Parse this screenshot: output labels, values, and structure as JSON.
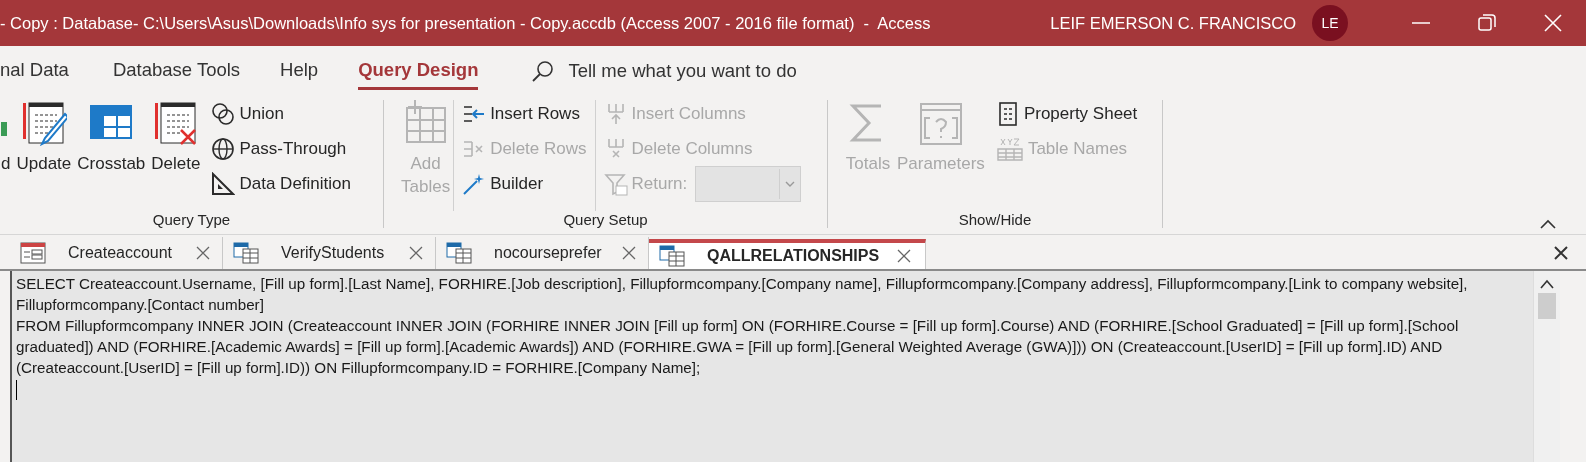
{
  "title_bar": {
    "title": "- Copy : Database- C:\\Users\\Asus\\Downloads\\Info sys for presentation - Copy.accdb (Access 2007 - 2016 file format)  -  Access",
    "user": "LEIF EMERSON C. FRANCISCO",
    "avatar": "LE"
  },
  "menu_tabs": [
    {
      "label": "nal Data",
      "selected": false
    },
    {
      "label": "Database Tools",
      "selected": false
    },
    {
      "label": "Help",
      "selected": false
    },
    {
      "label": "Query Design",
      "selected": true
    }
  ],
  "search": {
    "placeholder": "Tell me what you want to do"
  },
  "ribbon_groups": [
    {
      "label": "Query Type",
      "dividers": false,
      "items": [
        {
          "kind": "large",
          "label": "d",
          "disabled": false
        },
        {
          "kind": "large",
          "label": "Update",
          "disabled": false
        },
        {
          "kind": "large",
          "label": "Crosstab",
          "disabled": false
        },
        {
          "kind": "large",
          "label": "Delete",
          "disabled": false
        },
        {
          "kind": "small",
          "label": "Union",
          "disabled": false
        },
        {
          "kind": "small",
          "label": "Pass-Through",
          "disabled": false
        },
        {
          "kind": "small",
          "label": "Data Definition",
          "disabled": false
        }
      ]
    },
    {
      "label": "Query Setup",
      "dividers": true,
      "items": [
        {
          "kind": "large",
          "label": "Add\nTables",
          "disabled": true
        },
        {
          "kind": "small",
          "label": "Insert Rows",
          "disabled": false
        },
        {
          "kind": "small",
          "label": "Delete Rows",
          "disabled": true
        },
        {
          "kind": "small",
          "label": "Builder",
          "disabled": false
        },
        {
          "kind": "small",
          "label": "Insert Columns",
          "disabled": true
        },
        {
          "kind": "small",
          "label": "Delete Columns",
          "disabled": true
        },
        {
          "kind": "combo",
          "label": "Return:",
          "disabled": true
        }
      ]
    },
    {
      "label": "Show/Hide",
      "dividers": false,
      "items": [
        {
          "kind": "large",
          "label": "Totals",
          "disabled": true
        },
        {
          "kind": "large",
          "label": "Parameters",
          "disabled": true
        },
        {
          "kind": "small",
          "label": "Property Sheet",
          "disabled": false
        },
        {
          "kind": "small",
          "label": "Table Names",
          "disabled": true
        }
      ]
    }
  ],
  "doc_tabs": [
    {
      "kind": "form",
      "label": "Createaccount",
      "selected": false
    },
    {
      "kind": "query",
      "label": "VerifyStudents",
      "selected": false
    },
    {
      "kind": "query",
      "label": "nocourseprefer",
      "selected": false
    },
    {
      "kind": "query",
      "label": "QALLRELATIONSHIPS",
      "selected": true
    }
  ],
  "sql_lines": [
    "SELECT Createaccount.Username, [Fill up form].[Last Name], FORHIRE.[Job description], Fillupformcompany.[Company name], Fillupformcompany.[Company address], Fillupformcompany.[Link to company website],",
    "Fillupformcompany.[Contact number]",
    "FROM Fillupformcompany INNER JOIN (Createaccount INNER JOIN (FORHIRE INNER JOIN [Fill up form] ON (FORHIRE.Course = [Fill up form].Course) AND (FORHIRE.[School Graduated] = [Fill up form].[School",
    "graduated]) AND (FORHIRE.[Academic Awards] = [Fill up form].[Academic Awards]) AND (FORHIRE.GWA = [Fill up form].[General Weighted Average (GWA)])) ON (Createaccount.[UserID] = [Fill up form].ID) AND",
    "(Createaccount.[UserID] = [Fill up form].ID)) ON Fillupformcompany.ID = FORHIRE.[Company Name];"
  ]
}
